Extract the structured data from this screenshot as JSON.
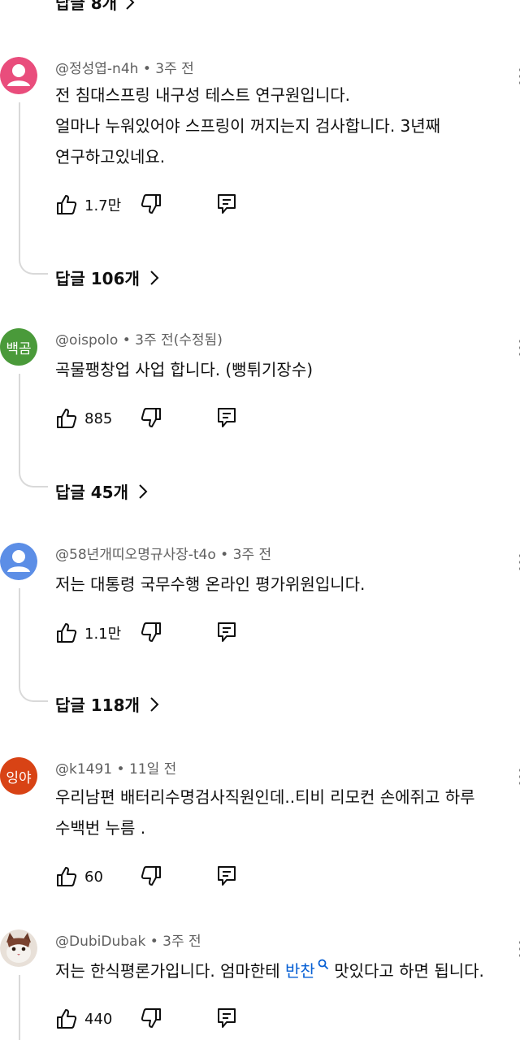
{
  "top_replies": {
    "label": "답글 8개"
  },
  "comments": [
    {
      "author": "@정성엽-n4h",
      "time": "3주 전",
      "text_lines": [
        "전 침대스프링 내구성 테스트 연구원입니다.",
        "얼마나 누워있어야 스프링이 꺼지는지 검사합니다. 3년째",
        "연구하고있네요."
      ],
      "likes": "1.7만",
      "replies": "답글 106개",
      "avatar_color": "#e94d7c"
    },
    {
      "author": "@oispolo",
      "time": "3주 전(수정됨)",
      "text_lines": [
        "곡물팽창업 사업 합니다. (뻥튀기장수)"
      ],
      "likes": "885",
      "replies": "답글 45개",
      "avatar_text": "백곰",
      "avatar_color": "#4a9a3a"
    },
    {
      "author": "@58년개띠오명규사장-t4o",
      "time": "3주 전",
      "text_lines": [
        "저는 대통령 국무수행 온라인 평가위원입니다."
      ],
      "likes": "1.1만",
      "replies": "답글 118개",
      "avatar_color": "#5c8ee6"
    },
    {
      "author": "@k1491",
      "time": "11일 전",
      "text_lines": [
        "우리남편 배터리수명검사직원인데..티비 리모컨 손에쥐고 하루",
        "수백번 누름 ."
      ],
      "likes": "60",
      "avatar_text": "잉야",
      "avatar_color": "#d84315"
    },
    {
      "author": "@DubiDubak",
      "time": "3주 전",
      "text_before": "저는 한식평론가입니다. 엄마한테 ",
      "text_link": "반찬",
      "text_after": " 맛있다고 하면 됩니다.",
      "likes": "440"
    }
  ],
  "icons": [
    "like-icon",
    "dislike-icon",
    "reply-icon",
    "chevron-right-icon",
    "more-vert-icon",
    "search-icon"
  ]
}
